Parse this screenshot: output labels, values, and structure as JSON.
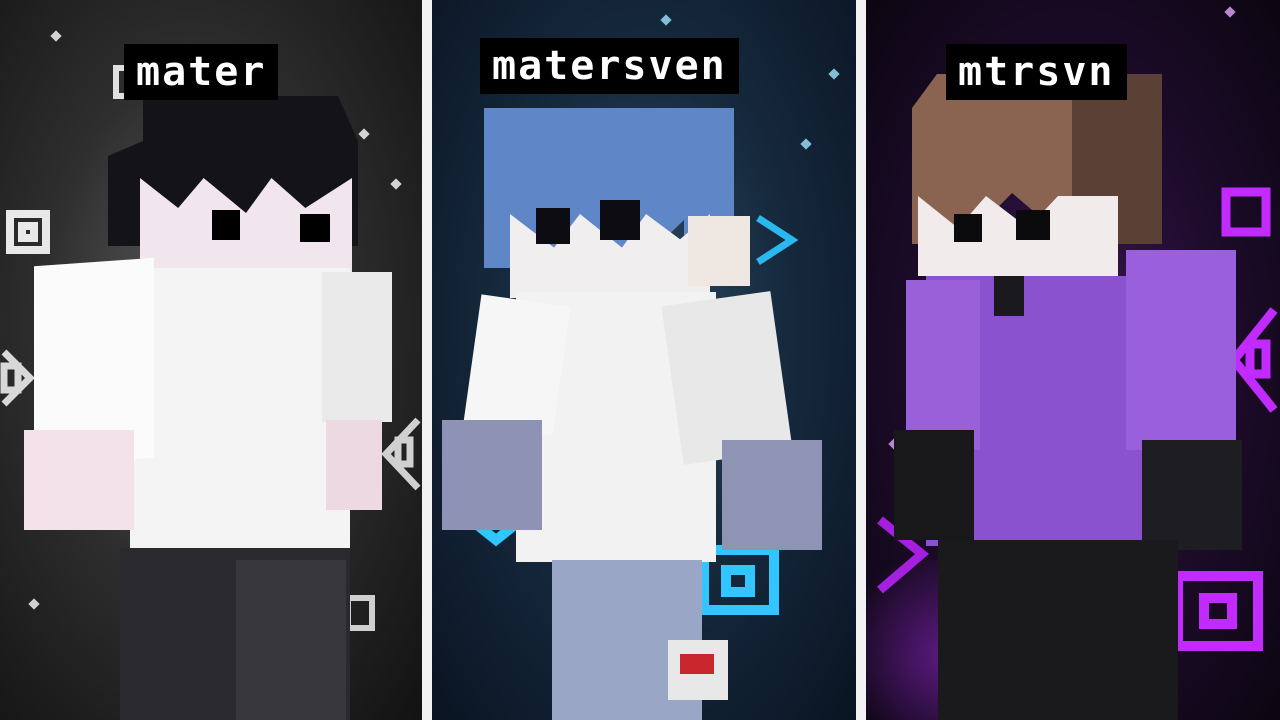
{
  "characters": [
    {
      "name": "mater",
      "theme": "monochrome",
      "accent": "#ffffff"
    },
    {
      "name": "matersven",
      "theme": "cyan",
      "accent": "#31c6ff"
    },
    {
      "name": "mtrsvn",
      "theme": "purple",
      "accent": "#c12bff"
    }
  ],
  "colors": {
    "divider": "#f2f2f2",
    "hair_black": "#121216",
    "hair_blue": "#5f87c8",
    "hair_brown": "#8a6450",
    "shirt_white": "#f4f4f4",
    "shirt_purple": "#8a52cf",
    "pants_dark": "#2a2a2e",
    "skin": "#f3ecef"
  }
}
